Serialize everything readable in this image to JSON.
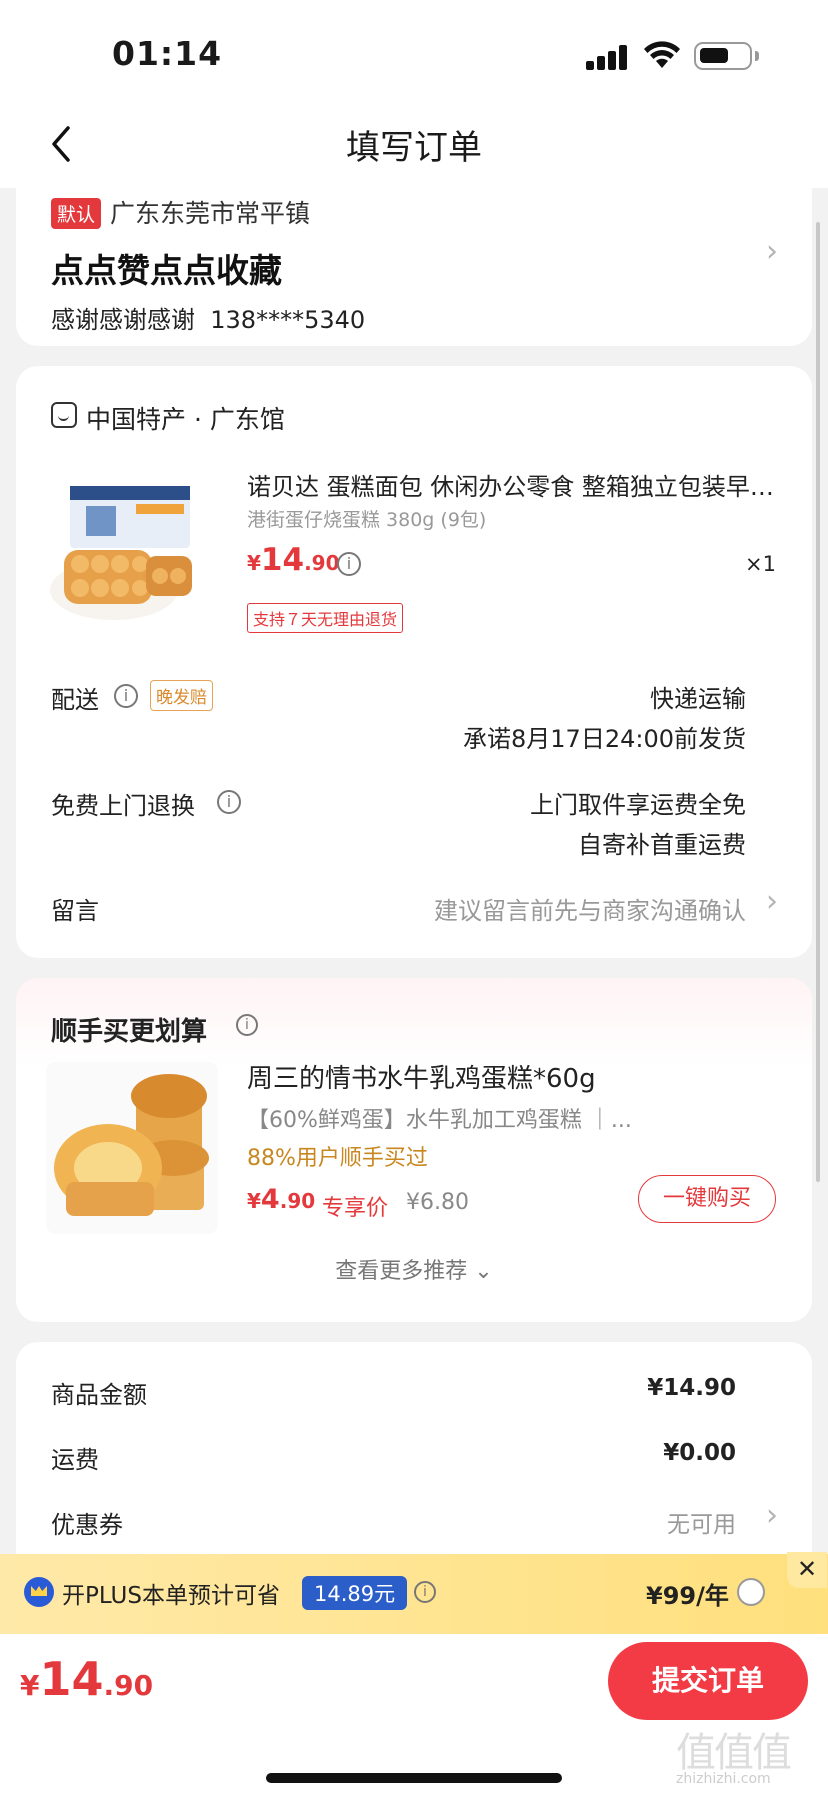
{
  "status": {
    "time": "01:14"
  },
  "header": {
    "title": "填写订单"
  },
  "address": {
    "tag": "默认",
    "region": "广东东莞市常平镇",
    "name": "点点赞点点收藏",
    "contact": "感谢感谢感谢",
    "phone": "138****5340"
  },
  "shop": {
    "name": "中国特产 · 广东馆"
  },
  "product": {
    "title": "诺贝达 蛋糕面包 休闲办公零食 整箱独立包装早餐小糕点点心 港街蛋仔烧蛋糕",
    "spec": "港街蛋仔烧蛋糕 380g (9包)",
    "price_symbol": "¥",
    "price_int": "14",
    "price_dec": ".90",
    "qty": "×1",
    "return_tag": "支持７天无理由退货"
  },
  "delivery": {
    "label": "配送",
    "late_tag": "晚发赔",
    "method": "快递运输",
    "promise": "承诺8月17日24:00前发货"
  },
  "free_return": {
    "label": "免费上门退换",
    "line1": "上门取件享运费全免",
    "line2": "自寄补首重运费"
  },
  "message": {
    "label": "留言",
    "placeholder": "建议留言前先与商家沟通确认"
  },
  "recommend": {
    "title": "顺手买更划算",
    "item_name": "周三的情书水牛乳鸡蛋糕*60g",
    "item_desc": "【60%鲜鸡蛋】水牛乳加工鸡蛋糕 ｜...",
    "bought": "88%用户顺手买过",
    "price_symbol": "¥",
    "price_int": "4",
    "price_dec": ".90",
    "exclusive": "专享价",
    "orig_price": "¥6.80",
    "buy_label": "一键购买",
    "more_label": "查看更多推荐 ⌄"
  },
  "summary": {
    "goods_label": "商品金额",
    "goods_value": "¥14.90",
    "shipping_label": "运费",
    "shipping_value": "¥0.00",
    "coupon_label": "优惠券",
    "coupon_value": "无可用"
  },
  "plus": {
    "text": "开PLUS本单预计可省",
    "save": "14.89元",
    "price": "¥99/年",
    "close": "✕"
  },
  "footer": {
    "total_symbol": "¥",
    "total_int": "14",
    "total_dec": ".90",
    "submit": "提交订单"
  },
  "watermark": {
    "big": "值值值",
    "small": "zhizhizhi.com"
  },
  "colors": {
    "accent": "#e4393c",
    "submit": "#f23b45",
    "plus_blue": "#2b5ec9"
  }
}
